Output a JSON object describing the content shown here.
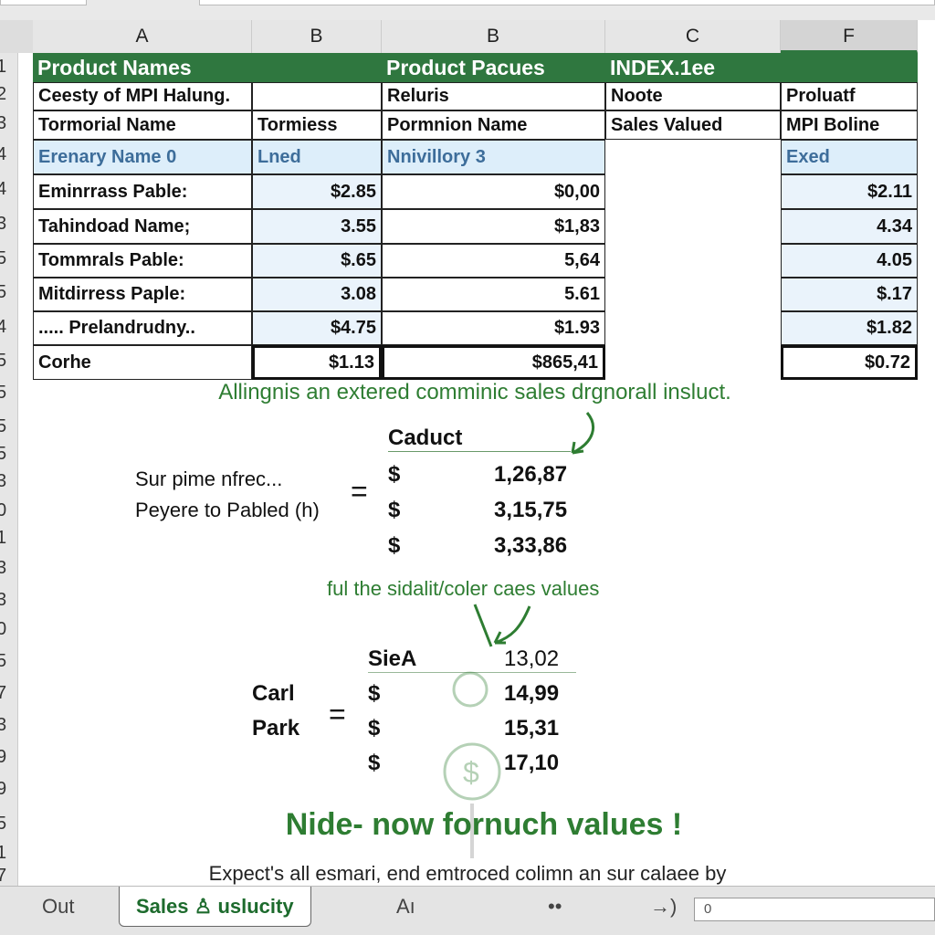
{
  "columns": [
    "A",
    "B",
    "B",
    "C",
    "F"
  ],
  "row_numbers": [
    "1",
    "2",
    "3",
    "4",
    "4",
    "3",
    "5",
    "5",
    "4",
    "5",
    "5",
    "5",
    "5",
    "3",
    "0",
    "1",
    "3",
    "3",
    "0",
    "5",
    "7",
    "3",
    "9",
    "9",
    "5",
    "1",
    "7"
  ],
  "header_row": [
    "Product Names",
    "",
    "Product Pacues",
    "INDEX.1ee",
    ""
  ],
  "row2": [
    "Ceesty of MPI Halung.",
    "",
    "Reluris",
    "Noote",
    "Proluatf"
  ],
  "row3": [
    "Tormorial Name",
    "Tormiess",
    "Pormnion Name",
    "Sales Valued",
    "MPI Boline"
  ],
  "row4": [
    "Erenary Name 0",
    "Lned",
    "Nnivillory 3",
    "",
    "Exed"
  ],
  "data_rows": [
    {
      "name": "Eminrrass Pable:",
      "b1": "$2.85",
      "b2": "$0,00",
      "f": "$2.11"
    },
    {
      "name": "Tahindoad Name;",
      "b1": "3.55",
      "b2": "$1,83",
      "f": "4.34"
    },
    {
      "name": "Tommrals Pable:",
      "b1": "$.65",
      "b2": "5,64",
      "f": "4.05"
    },
    {
      "name": "Mitdirress Paple:",
      "b1": "3.08",
      "b2": "5.61",
      "f": "$.17"
    },
    {
      "name": "..... Prelandrudny..",
      "b1": "$4.75",
      "b2": "$1.93",
      "f": "$1.82"
    }
  ],
  "total_row": {
    "name": "Corhe",
    "b1": "$1.13",
    "b2": "$865,41",
    "f": "$0.72"
  },
  "note1": "Allingnis an extered comminic sales drgnorall insluct.",
  "calc1": {
    "header": "Caduct",
    "label1": "Sur pime nfrec...",
    "label2": "Peyere to Pabled (h)",
    "equals": "=",
    "currency": "$",
    "values": [
      "1,26,87",
      "3,15,75",
      "3,33,86"
    ]
  },
  "note2": "ful the sidalit/coler caes values",
  "calc2": {
    "header": "SieA",
    "header_value": "13,02",
    "label1": "Carl",
    "label2": "Park",
    "equals": "=",
    "currency": "$",
    "values": [
      "14,99",
      "15,31",
      "17,10"
    ]
  },
  "headline": "Nide- now fornuch values !",
  "footer_note": "Expect's all esmari, end emtroced colimn an sur calaee by",
  "tabs": {
    "t1": "Out",
    "t2": "Sales ♙ uslucity",
    "t3": "Aı",
    "t4": "••",
    "t5": "→)",
    "input_value": "0"
  },
  "colors": {
    "accent": "#2f773f",
    "blue_text": "#3d6d9a",
    "note_green": "#2e7d32"
  }
}
